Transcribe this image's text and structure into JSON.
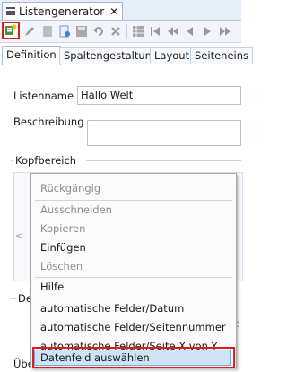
{
  "window": {
    "title": "Listengenerator",
    "close_glyph": "✕"
  },
  "toolbar": {
    "buttons": [
      "new-record-icon",
      "edit-icon",
      "copy-icon",
      "new-doc-icon",
      "save-icon",
      "undo-icon",
      "delete-icon",
      "grid-icon",
      "first-icon",
      "previous-icon",
      "play-previous-icon",
      "play-next-icon",
      "next-icon"
    ]
  },
  "tabs": [
    "Definition",
    "Spaltengestaltung",
    "Layout",
    "Seiteneins"
  ],
  "form": {
    "listenname_label": "Listenname",
    "listenname_value": "Hallo Welt",
    "beschreibung_label": "Beschreibung",
    "kopfbereich_label": "Kopfbereich",
    "de_label": "De",
    "ube_label": "Über",
    "partial_right": "te"
  },
  "context_menu": {
    "items": [
      {
        "label": "Rückgängig",
        "enabled": false
      },
      {
        "label": "Ausschneiden",
        "enabled": false
      },
      {
        "label": "Kopieren",
        "enabled": false
      },
      {
        "label": "Einfügen",
        "enabled": true
      },
      {
        "label": "Löschen",
        "enabled": false
      },
      {
        "label": "Hilfe",
        "enabled": true
      },
      {
        "label": "automatische Felder/Datum",
        "enabled": true
      },
      {
        "label": "automatische Felder/Seitennummer",
        "enabled": true
      },
      {
        "label": "automatische Felder/Seite X von Y",
        "enabled": true
      },
      {
        "label": "Datenfeld auswählen",
        "enabled": true,
        "highlighted": true
      }
    ]
  },
  "colors": {
    "highlight_red": "#e01b1b",
    "selection_blue": "#cfe3f7",
    "disabled_text": "#8e8e8e"
  }
}
